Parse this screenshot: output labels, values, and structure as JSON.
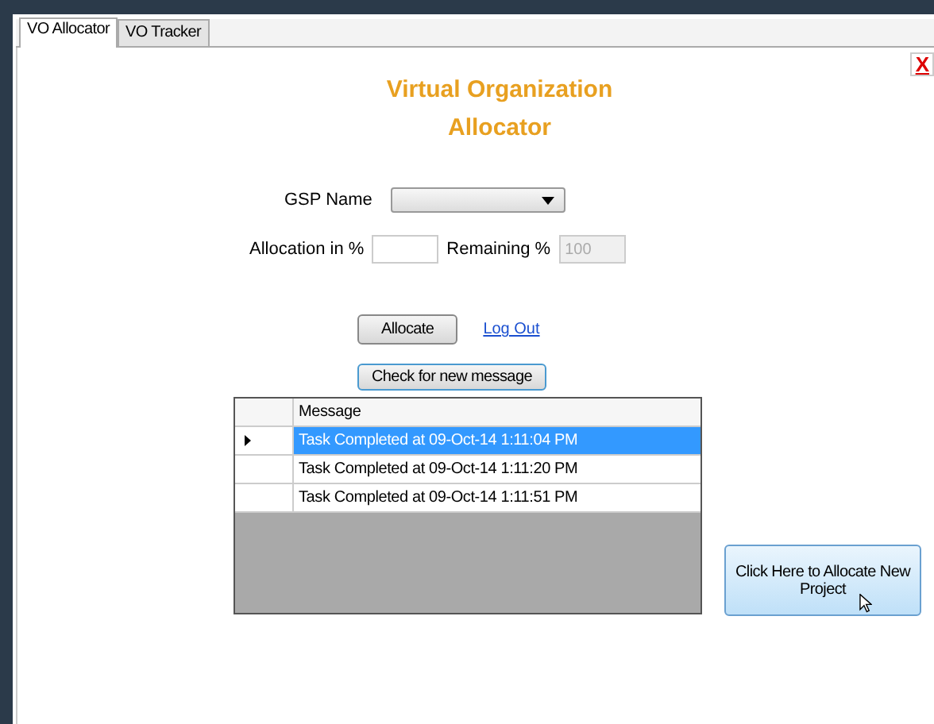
{
  "tabs": [
    {
      "label": "VO Allocator",
      "selected": true
    },
    {
      "label": "VO Tracker",
      "selected": false
    }
  ],
  "close_button": {
    "label": "X"
  },
  "title": [
    "Virtual Organization",
    "Allocator"
  ],
  "gsp_name": {
    "label": "GSP Name"
  },
  "allocation": {
    "label": "Allocation in %"
  },
  "remaining": {
    "label": "Remaining %",
    "value": "100",
    "disabled": true
  },
  "allocate_button": "Allocate",
  "logout_link": "Log Out",
  "check_button": "Check for new message",
  "grid": {
    "column": "Message",
    "rows": [
      {
        "message": "Task Completed at 09-Oct-14 1:11:04 PM",
        "selected": true
      },
      {
        "message": "Task Completed at 09-Oct-14 1:11:20 PM",
        "selected": false
      },
      {
        "message": "Task Completed at 09-Oct-14 1:11:51 PM",
        "selected": false
      }
    ]
  },
  "new_project_button": "Click Here to Allocate New Project"
}
